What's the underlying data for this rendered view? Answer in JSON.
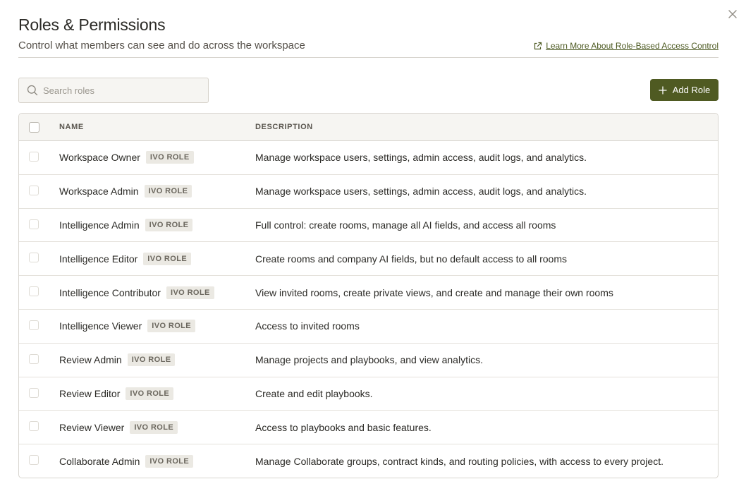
{
  "header": {
    "title": "Roles & Permissions",
    "subtitle": "Control what members can see and do across the workspace",
    "learn_more_link": "Learn More About Role-Based Access Control"
  },
  "search": {
    "placeholder": "Search roles",
    "value": ""
  },
  "toolbar": {
    "add_role_label": "Add Role"
  },
  "table": {
    "columns": [
      "NAME",
      "DESCRIPTION"
    ],
    "rows": [
      {
        "name": "Workspace Owner",
        "badge": "IVO ROLE",
        "description": "Manage workspace users, settings, admin access, audit logs, and analytics."
      },
      {
        "name": "Workspace Admin",
        "badge": "IVO ROLE",
        "description": "Manage workspace users, settings, admin access, audit logs, and analytics."
      },
      {
        "name": "Intelligence Admin",
        "badge": "IVO ROLE",
        "description": "Full control: create rooms, manage all AI fields, and access all rooms"
      },
      {
        "name": "Intelligence Editor",
        "badge": "IVO ROLE",
        "description": "Create rooms and company AI fields, but no default access to all rooms"
      },
      {
        "name": "Intelligence Contributor",
        "badge": "IVO ROLE",
        "description": "View invited rooms, create private views, and create and manage their own rooms"
      },
      {
        "name": "Intelligence Viewer",
        "badge": "IVO ROLE",
        "description": "Access to invited rooms"
      },
      {
        "name": "Review Admin",
        "badge": "IVO ROLE",
        "description": "Manage projects and playbooks, and view analytics."
      },
      {
        "name": "Review Editor",
        "badge": "IVO ROLE",
        "description": "Create and edit playbooks."
      },
      {
        "name": "Review Viewer",
        "badge": "IVO ROLE",
        "description": "Access to playbooks and basic features."
      },
      {
        "name": "Collaborate Admin",
        "badge": "IVO ROLE",
        "description": "Manage Collaborate groups, contract kinds, and routing policies, with access to every project."
      }
    ]
  },
  "icons": {
    "close": "close-icon",
    "external_link": "external-link-icon",
    "search": "search-icon",
    "add": "plus-icon"
  },
  "colors": {
    "accent": "#4f5a22",
    "link": "#4d5a22",
    "badge_bg": "#ebe9e3",
    "header_bg": "#f6f5f2"
  }
}
